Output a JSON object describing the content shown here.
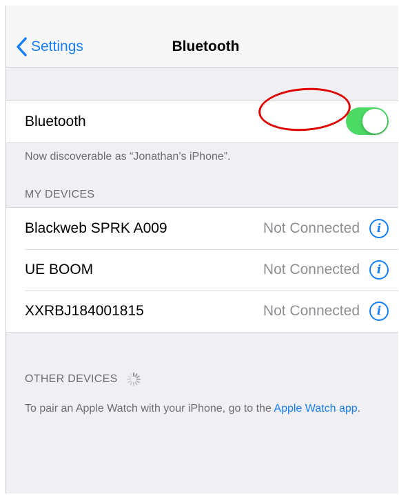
{
  "nav": {
    "back_label": "Settings",
    "title": "Bluetooth"
  },
  "bluetooth": {
    "label": "Bluetooth",
    "enabled": true,
    "toggle_color": "#4cd964",
    "discoverable_text": "Now discoverable as “Jonathan’s iPhone”."
  },
  "my_devices": {
    "header": "MY DEVICES",
    "items": [
      {
        "name": "Blackweb SPRK A009",
        "status": "Not Connected",
        "icon": "info-icon"
      },
      {
        "name": "UE BOOM",
        "status": "Not Connected",
        "icon": "info-icon"
      },
      {
        "name": "XXRBJ184001815",
        "status": "Not Connected",
        "icon": "info-icon"
      }
    ]
  },
  "other_devices": {
    "header": "OTHER DEVICES",
    "icon": "loading-spinner-icon",
    "note_prefix": "To pair an Apple Watch with your iPhone, go to the ",
    "note_link": "Apple Watch app",
    "note_suffix": "."
  },
  "colors": {
    "accent": "#157efb",
    "annotation": "#e00000"
  }
}
